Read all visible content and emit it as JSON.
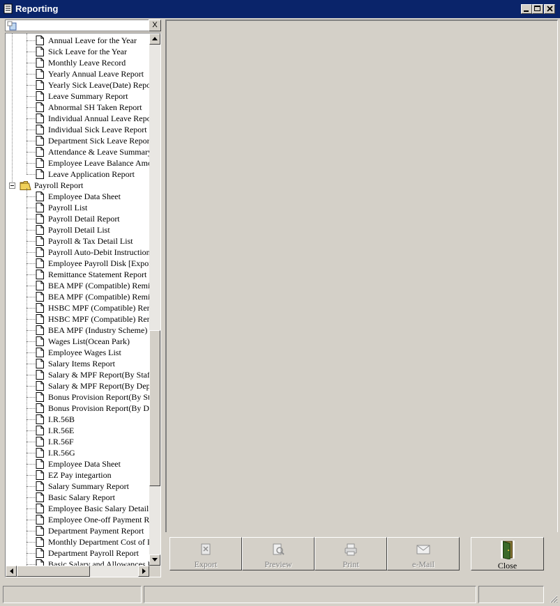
{
  "window": {
    "title": "Reporting"
  },
  "search": {
    "value": "",
    "clear_label": "X"
  },
  "tree": {
    "leave_items": [
      "Annual Leave for the Year",
      "Sick Leave for the Year",
      "Monthly Leave Record",
      "Yearly Annual Leave Report",
      "Yearly Sick Leave(Date) Report",
      "Leave Summary Report",
      "Abnormal SH Taken Report",
      "Individual Annual Leave Report",
      "Individual Sick Leave Report",
      "Department Sick Leave Report",
      "Attendance & Leave Summary",
      "Employee Leave Balance Amount",
      "Leave Application Report"
    ],
    "payroll_folder": {
      "label": "Payroll Report",
      "expanded": true
    },
    "payroll_items": [
      "Employee Data Sheet",
      "Payroll List",
      "Payroll Detail Report",
      "Payroll Detail List",
      "Payroll & Tax Detail List",
      "Payroll Auto-Debit Instruction",
      "Employee Payroll Disk [Export]",
      "Remittance Statement Report",
      "BEA MPF (Compatible) Remittance",
      "BEA MPF (Compatible) Remittance",
      "HSBC MPF (Compatible) Remittance",
      "HSBC MPF (Compatible) Remittance",
      "BEA MPF (Industry Scheme) C",
      "Wages List(Ocean Park)",
      "Employee Wages List",
      "Salary Items Report",
      "Salary & MPF Report(By Staff)",
      "Salary & MPF Report(By Dept)",
      "Bonus Provision Report(By Staff)",
      "Bonus Provision Report(By Dept)",
      "I.R.56B",
      "I.R.56E",
      "I.R.56F",
      "I.R.56G",
      "Employee Data Sheet",
      "EZ Pay integartion",
      "Salary Summary Report",
      "Basic Salary Report",
      "Employee Basic Salary Detail Report",
      "Employee One-off Payment Report",
      "Department Payment Report",
      "Monthly Department Cost of Labour",
      "Department Payroll Report",
      "Basic Salary and Allowances Report"
    ]
  },
  "actions": {
    "export": "Export",
    "preview": "Preview",
    "print": "Print",
    "email": "e-Mail",
    "close": "Close"
  },
  "status": {
    "cell1": "",
    "cell2": "",
    "cell3": ""
  },
  "colors": {
    "titlebar": "#0a246a",
    "face": "#d4d0c8",
    "folder": "#f0d058"
  }
}
